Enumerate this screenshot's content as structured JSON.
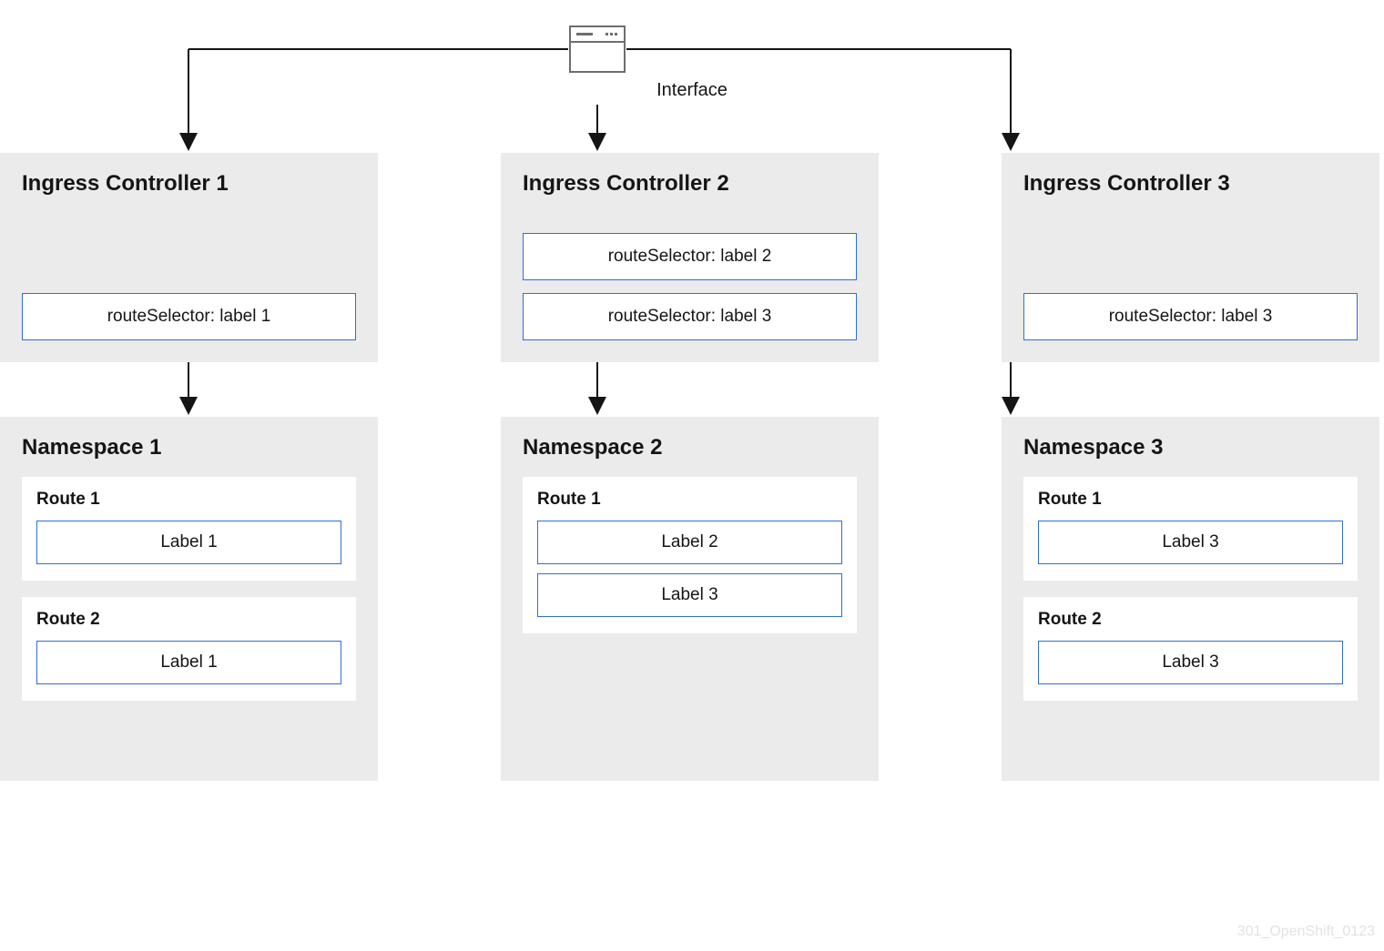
{
  "interface": {
    "label": "Interface"
  },
  "controllers": [
    {
      "title": "Ingress Controller 1",
      "selectors": [
        "routeSelector: label 1"
      ]
    },
    {
      "title": "Ingress Controller 2",
      "selectors": [
        "routeSelector: label 2",
        "routeSelector: label 3"
      ]
    },
    {
      "title": "Ingress Controller 3",
      "selectors": [
        "routeSelector: label 3"
      ]
    }
  ],
  "namespaces": [
    {
      "title": "Namespace 1",
      "routes": [
        {
          "title": "Route 1",
          "labels": [
            "Label 1"
          ]
        },
        {
          "title": "Route 2",
          "labels": [
            "Label 1"
          ]
        }
      ]
    },
    {
      "title": "Namespace 2",
      "routes": [
        {
          "title": "Route 1",
          "labels": [
            "Label 2",
            "Label 3"
          ]
        }
      ]
    },
    {
      "title": "Namespace 3",
      "routes": [
        {
          "title": "Route 1",
          "labels": [
            "Label 3"
          ]
        },
        {
          "title": "Route 2",
          "labels": [
            "Label 3"
          ]
        }
      ]
    }
  ],
  "watermark": "301_OpenShift_0123",
  "colors": {
    "box_bg": "#ebebeb",
    "border_blue": "#2b6fd9",
    "line": "#151515"
  }
}
